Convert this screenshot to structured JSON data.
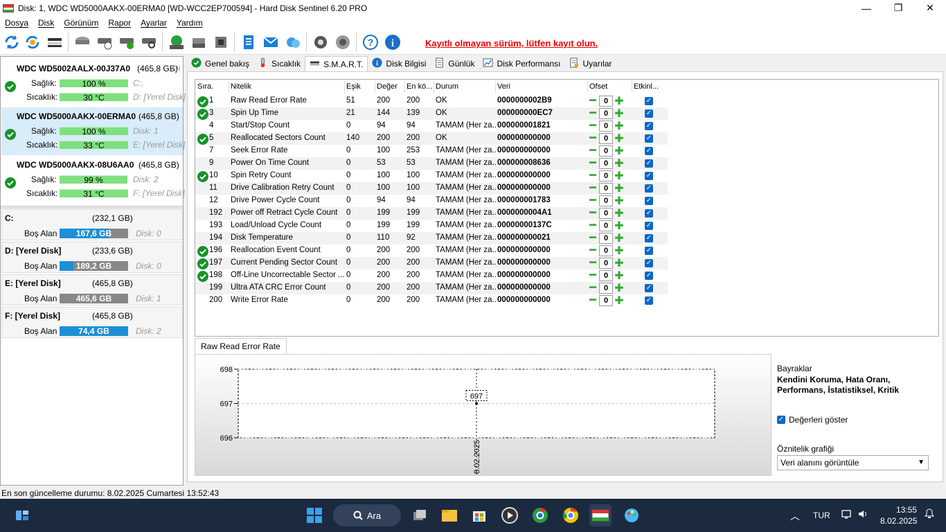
{
  "window": {
    "title": "Disk: 1, WDC WD5000AAKX-00ERMA0 [WD-WCC2EP700594]  -  Hard Disk Sentinel 6.20 PRO",
    "buttons": {
      "minimize": "—",
      "maximize": "❐",
      "close": "✕"
    }
  },
  "menu": [
    "Dosya",
    "Disk",
    "Görünüm",
    "Rapor",
    "Ayarlar",
    "Yardım"
  ],
  "toolbar": {
    "icons": [
      "refresh-icon",
      "refresh-all-icon",
      "disk-view-icon",
      "disk-icon",
      "disk-schedule-icon",
      "disk-check-icon",
      "disk-search-icon",
      "network-icon",
      "network-disk-icon",
      "disk-tool-icon",
      "report-icon",
      "mail-icon",
      "cloud-icon",
      "settings-icon",
      "sound-icon",
      "help-icon",
      "info-icon"
    ],
    "registration_note": "Kayıtlı olmayan sürüm, lütfen kayıt olun."
  },
  "disks": [
    {
      "name": "WDC WD5002AALX-00J37A0",
      "size": "(465,8 GB)",
      "suffix": "Di",
      "health_label": "Sağlık:",
      "health": "100 %",
      "health_pct": 100,
      "temp_label": "Sıcaklık:",
      "temp": "30 °C",
      "temp_pct": 100,
      "side1": "C:,",
      "side2": "D: [Yerel Disk]",
      "status": "ok"
    },
    {
      "name": "WDC WD5000AAKX-00ERMA0",
      "size": "(465,8 GB)",
      "health_label": "Sağlık:",
      "health": "100 %",
      "health_pct": 100,
      "temp_label": "Sıcaklık:",
      "temp": "33 °C",
      "temp_pct": 100,
      "side1": "Disk: 1",
      "side2": "E: [Yerel Disk]",
      "status": "ok",
      "selected": true
    },
    {
      "name": "WDC WD5000AAKX-08U6AA0",
      "size": "(465,8 GB)",
      "health_label": "Sağlık:",
      "health": "99 %",
      "health_pct": 99,
      "temp_label": "Sıcaklık:",
      "temp": "31 °C",
      "temp_pct": 100,
      "side1": "Disk: 2",
      "side2": "F: [Yerel Disk]",
      "status": "ok"
    }
  ],
  "volumes": [
    {
      "name": "C:",
      "size": "(232,1 GB)",
      "free_label": "Boş Alan",
      "free": "167,6 GB",
      "free_pct": 72,
      "disk": "Disk: 0"
    },
    {
      "name": "D: [Yerel Disk]",
      "size": "(233,6 GB)",
      "free_label": "Boş Alan",
      "free": "189,2 GB",
      "free_pct": 20,
      "disk": "Disk: 0"
    },
    {
      "name": "E: [Yerel Disk]",
      "size": "(465,8 GB)",
      "free_label": "Boş Alan",
      "free": "465,6 GB",
      "free_pct": 0,
      "disk": "Disk: 1"
    },
    {
      "name": "F: [Yerel Disk]",
      "size": "(465,8 GB)",
      "free_label": "Boş Alan",
      "free": "74,4 GB",
      "free_pct": 100,
      "disk": "Disk: 2"
    }
  ],
  "tabs": [
    {
      "label": "Genel bakış",
      "icon": "check-icon"
    },
    {
      "label": "Sıcaklık",
      "icon": "thermometer-icon"
    },
    {
      "label": "S.M.A.R.T.",
      "icon": "disk-icon",
      "active": true
    },
    {
      "label": "Disk Bilgisi",
      "icon": "info-icon"
    },
    {
      "label": "Günlük",
      "icon": "document-icon"
    },
    {
      "label": "Disk Performansı",
      "icon": "chart-icon"
    },
    {
      "label": "Uyarılar",
      "icon": "alert-document-icon"
    }
  ],
  "smart": {
    "headers": [
      "Sıra.",
      "Nitelik",
      "Eşik",
      "Değer",
      "En kö...",
      "Durum",
      "Veri",
      "Ofset",
      "Etkinl..."
    ],
    "rows": [
      {
        "id": "1",
        "name": "Raw Read Error Rate",
        "threshold": "51",
        "value": "200",
        "worst": "200",
        "status": "OK",
        "data": "0000000002B9",
        "offset": "0",
        "icon": true
      },
      {
        "id": "3",
        "name": "Spin Up Time",
        "threshold": "21",
        "value": "144",
        "worst": "139",
        "status": "OK",
        "data": "000000000EC7",
        "offset": "0",
        "icon": true
      },
      {
        "id": "4",
        "name": "Start/Stop Count",
        "threshold": "0",
        "value": "94",
        "worst": "94",
        "status": "TAMAM (Her za...",
        "data": "000000001821",
        "offset": "0",
        "icon": false
      },
      {
        "id": "5",
        "name": "Reallocated Sectors Count",
        "threshold": "140",
        "value": "200",
        "worst": "200",
        "status": "OK",
        "data": "000000000000",
        "offset": "0",
        "icon": true
      },
      {
        "id": "7",
        "name": "Seek Error Rate",
        "threshold": "0",
        "value": "100",
        "worst": "253",
        "status": "TAMAM (Her za...",
        "data": "000000000000",
        "offset": "0",
        "icon": false
      },
      {
        "id": "9",
        "name": "Power On Time Count",
        "threshold": "0",
        "value": "53",
        "worst": "53",
        "status": "TAMAM (Her za...",
        "data": "000000008636",
        "offset": "0",
        "icon": false
      },
      {
        "id": "10",
        "name": "Spin Retry Count",
        "threshold": "0",
        "value": "100",
        "worst": "100",
        "status": "TAMAM (Her za...",
        "data": "000000000000",
        "offset": "0",
        "icon": true
      },
      {
        "id": "11",
        "name": "Drive Calibration Retry Count",
        "threshold": "0",
        "value": "100",
        "worst": "100",
        "status": "TAMAM (Her za...",
        "data": "000000000000",
        "offset": "0",
        "icon": false
      },
      {
        "id": "12",
        "name": "Drive Power Cycle Count",
        "threshold": "0",
        "value": "94",
        "worst": "94",
        "status": "TAMAM (Her za...",
        "data": "000000001783",
        "offset": "0",
        "icon": false
      },
      {
        "id": "192",
        "name": "Power off Retract Cycle Count",
        "threshold": "0",
        "value": "199",
        "worst": "199",
        "status": "TAMAM (Her za...",
        "data": "0000000004A1",
        "offset": "0",
        "icon": false
      },
      {
        "id": "193",
        "name": "Load/Unload Cycle Count",
        "threshold": "0",
        "value": "199",
        "worst": "199",
        "status": "TAMAM (Her za...",
        "data": "00000000137C",
        "offset": "0",
        "icon": false
      },
      {
        "id": "194",
        "name": "Disk Temperature",
        "threshold": "0",
        "value": "110",
        "worst": "92",
        "status": "TAMAM (Her za...",
        "data": "000000000021",
        "offset": "0",
        "icon": false
      },
      {
        "id": "196",
        "name": "Reallocation Event Count",
        "threshold": "0",
        "value": "200",
        "worst": "200",
        "status": "TAMAM (Her za...",
        "data": "000000000000",
        "offset": "0",
        "icon": true
      },
      {
        "id": "197",
        "name": "Current Pending Sector Count",
        "threshold": "0",
        "value": "200",
        "worst": "200",
        "status": "TAMAM (Her za...",
        "data": "000000000000",
        "offset": "0",
        "icon": true
      },
      {
        "id": "198",
        "name": "Off-Line Uncorrectable Sector ...",
        "threshold": "0",
        "value": "200",
        "worst": "200",
        "status": "TAMAM (Her za...",
        "data": "000000000000",
        "offset": "0",
        "icon": true
      },
      {
        "id": "199",
        "name": "Ultra ATA CRC Error Count",
        "threshold": "0",
        "value": "200",
        "worst": "200",
        "status": "TAMAM (Her za...",
        "data": "000000000000",
        "offset": "0",
        "icon": false
      },
      {
        "id": "200",
        "name": "Write Error Rate",
        "threshold": "0",
        "value": "200",
        "worst": "200",
        "status": "TAMAM (Her za...",
        "data": "000000000000",
        "offset": "0",
        "icon": false
      }
    ]
  },
  "graph": {
    "tab": "Raw Read Error Rate",
    "yticks": [
      "698",
      "697",
      "696"
    ],
    "point_label": "697",
    "x_label": "8.02.2025"
  },
  "chart_data": {
    "type": "line",
    "x": [
      "8.02.2025"
    ],
    "series": [
      {
        "values": [
          697
        ]
      }
    ],
    "ylim": [
      696,
      698
    ],
    "yticks": [
      696,
      697,
      698
    ]
  },
  "flags": {
    "title": "Bayraklar",
    "text": "Kendini Koruma, Hata Oranı, Performans, İstatistiksel, Kritik",
    "show_values": "Değerleri göster",
    "graph_label": "Öznitelik grafiği",
    "graph_option": "Veri alanını görüntüle"
  },
  "status": "En son güncelleme durumu: 8.02.2025 Cumartesi 13:52:43",
  "taskbar": {
    "search": "Ara",
    "lang": "TUR",
    "time": "13:55",
    "date": "8.02.2025"
  }
}
